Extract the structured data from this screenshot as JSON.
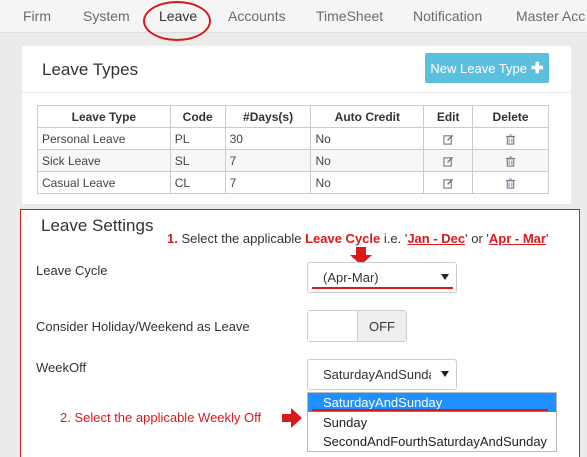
{
  "tabs": [
    {
      "label": "Firm"
    },
    {
      "label": "System"
    },
    {
      "label": "Leave"
    },
    {
      "label": "Accounts"
    },
    {
      "label": "TimeSheet"
    },
    {
      "label": "Notification"
    },
    {
      "label": "Master Acc"
    }
  ],
  "leave_types": {
    "title": "Leave Types",
    "new_button_label": "New Leave Type",
    "columns": [
      "Leave Type",
      "Code",
      "#Days(s)",
      "Auto Credit",
      "Edit",
      "Delete"
    ],
    "rows": [
      {
        "type": "Personal Leave",
        "code": "PL",
        "days": "30",
        "auto_credit": "No"
      },
      {
        "type": "Sick Leave",
        "code": "SL",
        "days": "7",
        "auto_credit": "No"
      },
      {
        "type": "Casual Leave",
        "code": "CL",
        "days": "7",
        "auto_credit": "No"
      }
    ]
  },
  "settings": {
    "title": "Leave Settings",
    "leave_cycle_label": "Leave Cycle",
    "leave_cycle_value": "(Apr-Mar)",
    "holiday_label": "Consider Holiday/Weekend as Leave",
    "holiday_toggle": "OFF",
    "weekoff_label": "WeekOff",
    "weekoff_value": "SaturdayAndSunday",
    "weekoff_options": [
      "SaturdayAndSunday",
      "Sunday",
      "SecondAndFourthSaturdayAndSunday"
    ]
  },
  "annotations": {
    "note1_num": "1.",
    "note1_pre": "Select the applicable",
    "note1_bold": "Leave Cycle",
    "note1_ie": "i.e. '",
    "note1_opt1": "Jan - Dec",
    "note1_or": "' or '",
    "note1_opt2": "Apr - Mar",
    "note1_end": "'",
    "note2": "2. Select the applicable Weekly Off",
    "color": "#d9191c"
  }
}
